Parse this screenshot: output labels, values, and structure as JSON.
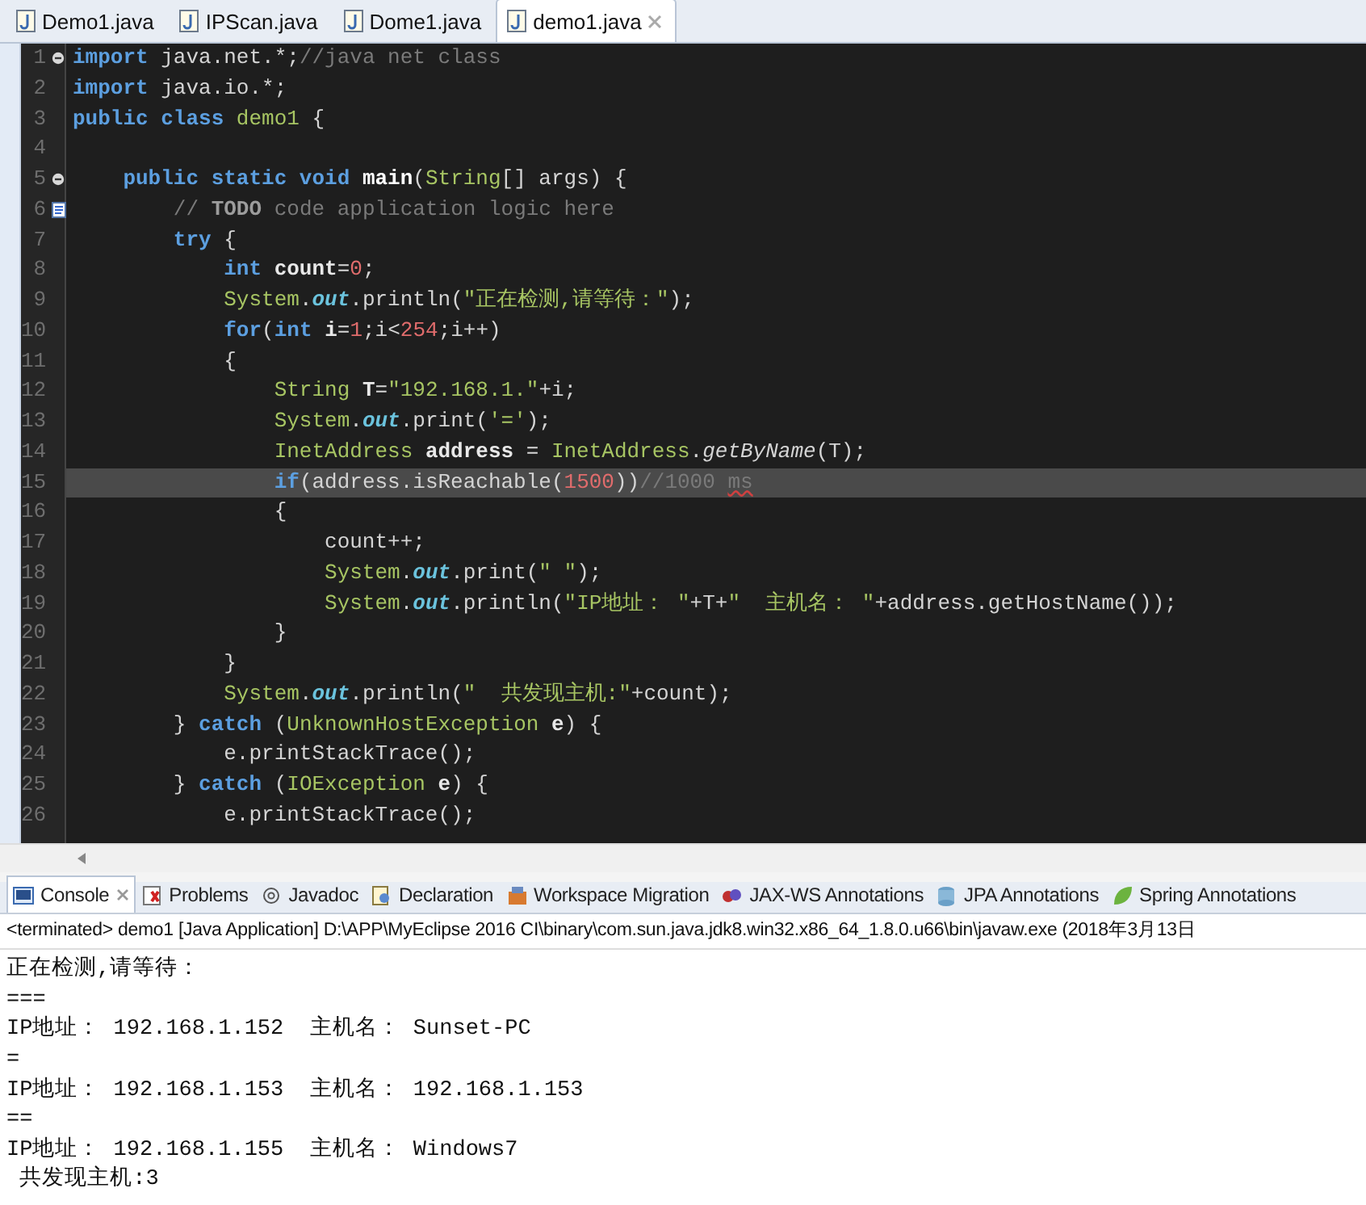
{
  "editor_tabs": [
    {
      "label": "Demo1.java",
      "selected": false
    },
    {
      "label": "IPScan.java",
      "selected": false
    },
    {
      "label": "Dome1.java",
      "selected": false
    },
    {
      "label": "demo1.java",
      "selected": true
    }
  ],
  "code_lines": [
    {
      "number": "1",
      "foldable": true,
      "current": false,
      "tokens": [
        {
          "kind": "keyword",
          "text": "import"
        },
        {
          "kind": "plain",
          "text": " java.net.*;"
        },
        {
          "kind": "comment",
          "text": "//java net class"
        }
      ]
    },
    {
      "number": "2",
      "current": false,
      "tokens": [
        {
          "kind": "keyword",
          "text": "import"
        },
        {
          "kind": "plain",
          "text": " java.io.*;"
        }
      ]
    },
    {
      "number": "3",
      "current": false,
      "tokens": [
        {
          "kind": "keyword",
          "text": "public class "
        },
        {
          "kind": "type",
          "text": "demo1"
        },
        {
          "kind": "plain",
          "text": " {"
        }
      ]
    },
    {
      "number": "4",
      "current": false
    },
    {
      "number": "5",
      "foldable": true,
      "current": false,
      "tokens": [
        {
          "kind": "keyword",
          "text": "    public static void "
        },
        {
          "kind": "declaration",
          "text": "main"
        },
        {
          "kind": "plain",
          "text": "("
        },
        {
          "kind": "type",
          "text": "String"
        },
        {
          "kind": "plain",
          "text": "[] args) {"
        }
      ]
    },
    {
      "number": "6",
      "task": true,
      "current": false,
      "tokens": [
        {
          "kind": "comment",
          "text": "        // "
        },
        {
          "kind": "todo",
          "text": "TODO"
        },
        {
          "kind": "comment",
          "text": " code application logic here"
        }
      ]
    },
    {
      "number": "7",
      "current": false,
      "tokens": [
        {
          "kind": "keyword",
          "text": "        try"
        },
        {
          "kind": "plain",
          "text": " {"
        }
      ]
    },
    {
      "number": "8",
      "current": false,
      "tokens": [
        {
          "kind": "keyword",
          "text": "            int "
        },
        {
          "kind": "local",
          "text": "count"
        },
        {
          "kind": "plain",
          "text": "="
        },
        {
          "kind": "number",
          "text": "0"
        },
        {
          "kind": "plain",
          "text": ";"
        }
      ]
    },
    {
      "number": "9",
      "current": false,
      "tokens": [
        {
          "kind": "type",
          "text": "            System"
        },
        {
          "kind": "plain",
          "text": "."
        },
        {
          "kind": "field",
          "text": "out"
        },
        {
          "kind": "plain",
          "text": ".println("
        },
        {
          "kind": "string",
          "text": "\"正在检测,请等待：\""
        },
        {
          "kind": "plain",
          "text": ");"
        }
      ]
    },
    {
      "number": "10",
      "current": false,
      "tokens": [
        {
          "kind": "keyword",
          "text": "            for"
        },
        {
          "kind": "plain",
          "text": "("
        },
        {
          "kind": "keyword",
          "text": "int "
        },
        {
          "kind": "local",
          "text": "i"
        },
        {
          "kind": "plain",
          "text": "="
        },
        {
          "kind": "number",
          "text": "1"
        },
        {
          "kind": "plain",
          "text": ";i<"
        },
        {
          "kind": "number",
          "text": "254"
        },
        {
          "kind": "plain",
          "text": ";i++)"
        }
      ]
    },
    {
      "number": "11",
      "current": false,
      "tokens": [
        {
          "kind": "plain",
          "text": "            {"
        }
      ]
    },
    {
      "number": "12",
      "current": false,
      "tokens": [
        {
          "kind": "type",
          "text": "                String "
        },
        {
          "kind": "local",
          "text": "T"
        },
        {
          "kind": "plain",
          "text": "="
        },
        {
          "kind": "string",
          "text": "\"192.168.1.\""
        },
        {
          "kind": "plain",
          "text": "+i;"
        }
      ]
    },
    {
      "number": "13",
      "current": false,
      "tokens": [
        {
          "kind": "type",
          "text": "                System"
        },
        {
          "kind": "plain",
          "text": "."
        },
        {
          "kind": "field",
          "text": "out"
        },
        {
          "kind": "plain",
          "text": ".print("
        },
        {
          "kind": "string",
          "text": "'='"
        },
        {
          "kind": "plain",
          "text": ");"
        }
      ]
    },
    {
      "number": "14",
      "current": false,
      "tokens": [
        {
          "kind": "type",
          "text": "                InetAddress "
        },
        {
          "kind": "local",
          "text": "address"
        },
        {
          "kind": "plain",
          "text": " = "
        },
        {
          "kind": "type",
          "text": "InetAddress"
        },
        {
          "kind": "plain",
          "text": "."
        },
        {
          "kind": "static-method",
          "text": "getByName"
        },
        {
          "kind": "plain",
          "text": "(T);"
        }
      ]
    },
    {
      "number": "15",
      "current": true,
      "tokens": [
        {
          "kind": "keyword",
          "text": "                if"
        },
        {
          "kind": "plain",
          "text": "(address.isReachable("
        },
        {
          "kind": "number",
          "text": "1500"
        },
        {
          "kind": "plain",
          "text": "))"
        },
        {
          "kind": "comment",
          "text": "//1000 "
        },
        {
          "kind": "misspelled",
          "text": "ms"
        }
      ]
    },
    {
      "number": "16",
      "current": false,
      "tokens": [
        {
          "kind": "plain",
          "text": "                {"
        }
      ]
    },
    {
      "number": "17",
      "current": false,
      "tokens": [
        {
          "kind": "plain",
          "text": "                    count++;"
        }
      ]
    },
    {
      "number": "18",
      "current": false,
      "tokens": [
        {
          "kind": "type",
          "text": "                    System"
        },
        {
          "kind": "plain",
          "text": "."
        },
        {
          "kind": "field",
          "text": "out"
        },
        {
          "kind": "plain",
          "text": ".print("
        },
        {
          "kind": "string",
          "text": "\" \""
        },
        {
          "kind": "plain",
          "text": ");"
        }
      ]
    },
    {
      "number": "19",
      "current": false,
      "tokens": [
        {
          "kind": "type",
          "text": "                    System"
        },
        {
          "kind": "plain",
          "text": "."
        },
        {
          "kind": "field",
          "text": "out"
        },
        {
          "kind": "plain",
          "text": ".println("
        },
        {
          "kind": "string",
          "text": "\"IP地址： \""
        },
        {
          "kind": "plain",
          "text": "+T+"
        },
        {
          "kind": "string",
          "text": "\"  主机名： \""
        },
        {
          "kind": "plain",
          "text": "+address.getHostName());"
        }
      ]
    },
    {
      "number": "20",
      "current": false,
      "tokens": [
        {
          "kind": "plain",
          "text": "                }"
        }
      ]
    },
    {
      "number": "21",
      "current": false,
      "tokens": [
        {
          "kind": "plain",
          "text": "            }"
        }
      ]
    },
    {
      "number": "22",
      "current": false,
      "tokens": [
        {
          "kind": "type",
          "text": "            System"
        },
        {
          "kind": "plain",
          "text": "."
        },
        {
          "kind": "field",
          "text": "out"
        },
        {
          "kind": "plain",
          "text": ".println("
        },
        {
          "kind": "string",
          "text": "\"  共发现主机:\""
        },
        {
          "kind": "plain",
          "text": "+count);"
        }
      ]
    },
    {
      "number": "23",
      "current": false,
      "tokens": [
        {
          "kind": "plain",
          "text": "        } "
        },
        {
          "kind": "keyword",
          "text": "catch"
        },
        {
          "kind": "plain",
          "text": " ("
        },
        {
          "kind": "type",
          "text": "UnknownHostException "
        },
        {
          "kind": "local",
          "text": "e"
        },
        {
          "kind": "plain",
          "text": ") {"
        }
      ]
    },
    {
      "number": "24",
      "current": false,
      "tokens": [
        {
          "kind": "plain",
          "text": "            e.printStackTrace();"
        }
      ]
    },
    {
      "number": "25",
      "current": false,
      "tokens": [
        {
          "kind": "plain",
          "text": "        } "
        },
        {
          "kind": "keyword",
          "text": "catch"
        },
        {
          "kind": "plain",
          "text": " ("
        },
        {
          "kind": "type",
          "text": "IOException "
        },
        {
          "kind": "local",
          "text": "e"
        },
        {
          "kind": "plain",
          "text": ") {"
        }
      ]
    },
    {
      "number": "26",
      "current": false,
      "tokens": [
        {
          "kind": "plain",
          "text": "            e.printStackTrace();"
        }
      ]
    }
  ],
  "console_tabs": [
    {
      "label": "Console",
      "selected": true
    },
    {
      "label": "Problems",
      "selected": false
    },
    {
      "label": "Javadoc",
      "selected": false
    },
    {
      "label": "Declaration",
      "selected": false
    },
    {
      "label": "Workspace Migration",
      "selected": false
    },
    {
      "label": "JAX-WS Annotations",
      "selected": false
    },
    {
      "label": "JPA Annotations",
      "selected": false
    },
    {
      "label": "Spring Annotations",
      "selected": false
    }
  ],
  "console_status": "<terminated> demo1 [Java Application] D:\\APP\\MyEclipse 2016 CI\\binary\\com.sun.java.jdk8.win32.x86_64_1.8.0.u66\\bin\\javaw.exe (2018年3月13日",
  "console_output": [
    "正在检测,请等待：",
    "===",
    "IP地址： 192.168.1.152  主机名： Sunset-PC",
    "=",
    "IP地址： 192.168.1.153  主机名： 192.168.1.153",
    "==",
    "IP地址： 192.168.1.155  主机名： Windows7",
    " 共发现主机:3"
  ]
}
